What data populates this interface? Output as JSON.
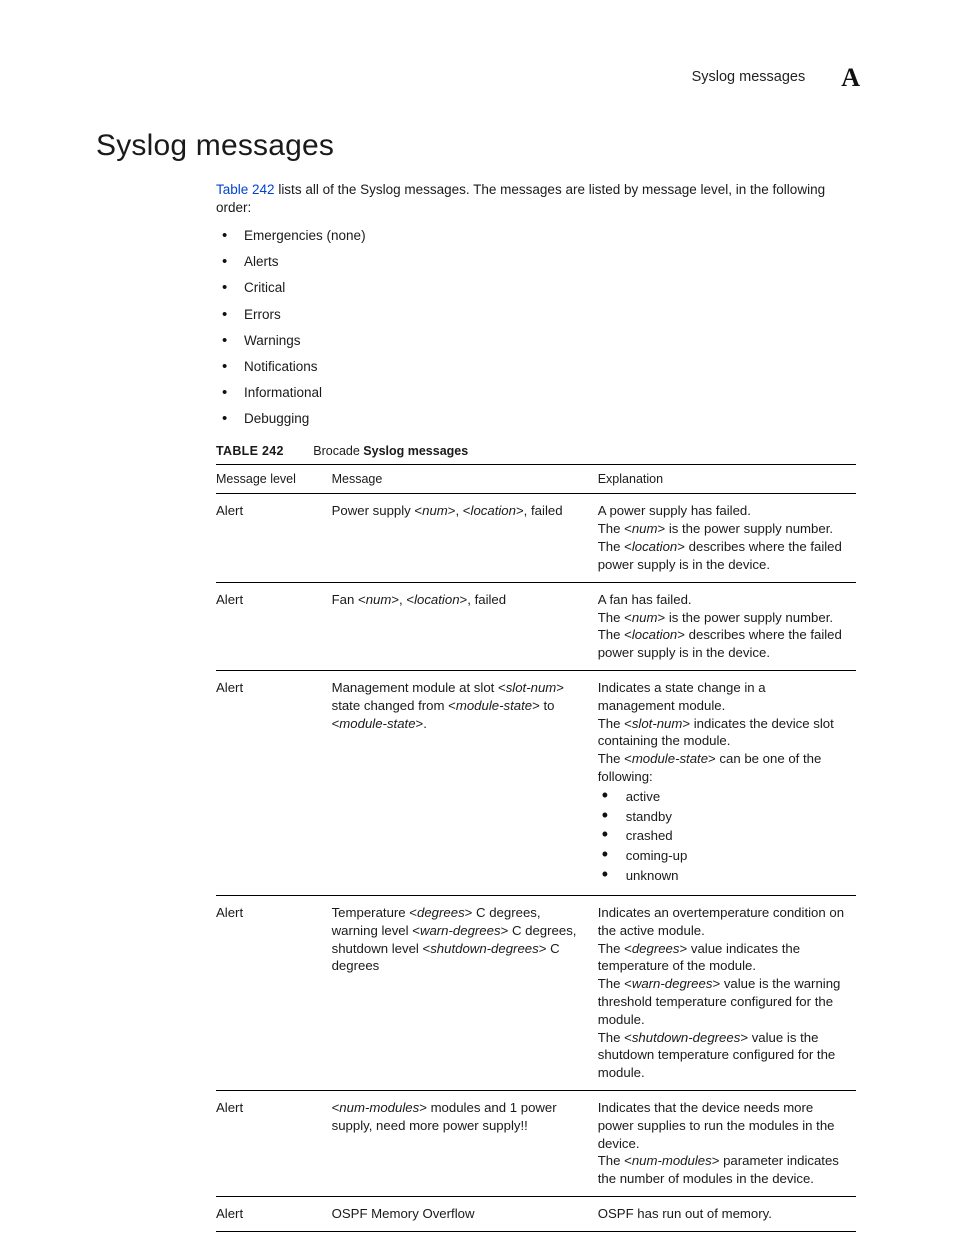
{
  "running_head": {
    "title": "Syslog messages",
    "chapter": "A"
  },
  "section_title": "Syslog messages",
  "intro": {
    "link_text": "Table 242",
    "rest_text": " lists all of the Syslog messages. The messages are listed by message level, in the following order:",
    "levels": [
      "Emergencies (none)",
      "Alerts",
      "Critical",
      "Errors",
      "Warnings",
      "Notifications",
      "Informational",
      "Debugging"
    ]
  },
  "table": {
    "number_label": "TABLE 242",
    "title_prefix": "Brocade ",
    "title_bold": "Syslog messages",
    "headers": {
      "level": "Message level",
      "message": "Message",
      "explanation": "Explanation"
    },
    "rows": [
      {
        "level": "Alert",
        "message_segments": [
          {
            "t": "Power supply <"
          },
          {
            "t": "num",
            "i": true
          },
          {
            "t": ">, <"
          },
          {
            "t": "location",
            "i": true
          },
          {
            "t": ">, failed"
          }
        ],
        "explanation_lines": [
          [
            {
              "t": "A power supply has failed."
            }
          ],
          [
            {
              "t": "The <"
            },
            {
              "t": "num",
              "i": true
            },
            {
              "t": "> is the power supply number."
            }
          ],
          [
            {
              "t": "The <"
            },
            {
              "t": "location",
              "i": true
            },
            {
              "t": "> describes where the failed power supply is in the device."
            }
          ]
        ]
      },
      {
        "level": "Alert",
        "message_segments": [
          {
            "t": "Fan <"
          },
          {
            "t": "num",
            "i": true
          },
          {
            "t": ">, <"
          },
          {
            "t": "location",
            "i": true
          },
          {
            "t": ">, failed"
          }
        ],
        "explanation_lines": [
          [
            {
              "t": "A fan has failed."
            }
          ],
          [
            {
              "t": "The <"
            },
            {
              "t": "num",
              "i": true
            },
            {
              "t": "> is the power supply number."
            }
          ],
          [
            {
              "t": "The <"
            },
            {
              "t": "location",
              "i": true
            },
            {
              "t": "> describes where the failed power supply is in the device."
            }
          ]
        ]
      },
      {
        "level": "Alert",
        "message_segments": [
          {
            "t": "Management module at slot <"
          },
          {
            "t": "slot-num",
            "i": true
          },
          {
            "t": "> state changed from <"
          },
          {
            "t": "module-state",
            "i": true
          },
          {
            "t": "> to <"
          },
          {
            "t": "module-state",
            "i": true
          },
          {
            "t": ">."
          }
        ],
        "explanation_lines": [
          [
            {
              "t": "Indicates a state change in a management module."
            }
          ],
          [
            {
              "t": "The <"
            },
            {
              "t": "slot-num",
              "i": true
            },
            {
              "t": "> indicates the device slot containing the module."
            }
          ],
          [
            {
              "t": "The <"
            },
            {
              "t": "module-state",
              "i": true
            },
            {
              "t": "> can be one of the following:"
            }
          ]
        ],
        "sublist": [
          "active",
          "standby",
          "crashed",
          "coming-up",
          "unknown"
        ]
      },
      {
        "level": "Alert",
        "message_segments": [
          {
            "t": "Temperature <"
          },
          {
            "t": "degrees",
            "i": true
          },
          {
            "t": "> C degrees, warning level <"
          },
          {
            "t": "warn-degrees",
            "i": true
          },
          {
            "t": "> C degrees, shutdown level <"
          },
          {
            "t": "shutdown-degrees",
            "i": true
          },
          {
            "t": "> C degrees"
          }
        ],
        "explanation_lines": [
          [
            {
              "t": "Indicates an overtemperature condition on the active module."
            }
          ],
          [
            {
              "t": "The <"
            },
            {
              "t": "degrees",
              "i": true
            },
            {
              "t": "> value indicates the temperature of the module."
            }
          ],
          [
            {
              "t": "The <"
            },
            {
              "t": "warn-degrees",
              "i": true
            },
            {
              "t": "> value is the warning threshold temperature configured for the module."
            }
          ],
          [
            {
              "t": "The <"
            },
            {
              "t": "shutdown-degrees",
              "i": true
            },
            {
              "t": "> value is the shutdown temperature configured for the module."
            }
          ]
        ]
      },
      {
        "level": "Alert",
        "message_segments": [
          {
            "t": "<"
          },
          {
            "t": "num-modules",
            "i": true
          },
          {
            "t": "> modules and 1 power supply, need more power supply!!"
          }
        ],
        "explanation_lines": [
          [
            {
              "t": "Indicates that the device needs more power supplies to run the modules in the device."
            }
          ],
          [
            {
              "t": "The <"
            },
            {
              "t": "num-modules",
              "i": true
            },
            {
              "t": "> parameter indicates the number of modules in the device."
            }
          ]
        ]
      },
      {
        "level": "Alert",
        "message_segments": [
          {
            "t": "OSPF Memory Overflow"
          }
        ],
        "explanation_lines": [
          [
            {
              "t": "OSPF has run out of memory."
            }
          ]
        ]
      }
    ]
  }
}
